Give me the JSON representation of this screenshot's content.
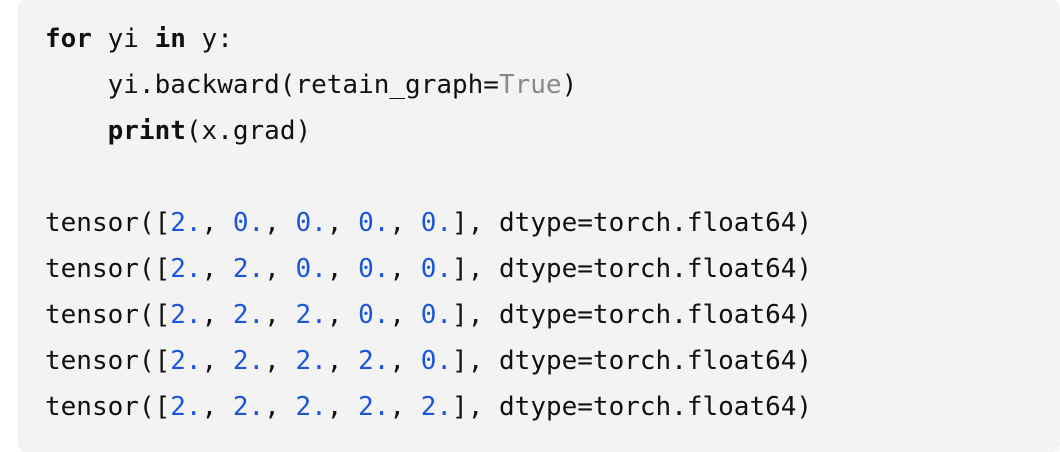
{
  "code": {
    "line1": {
      "kw_for": "for",
      "t1": " yi ",
      "kw_in": "in",
      "t2": " y:"
    },
    "line2": {
      "indent": "    ",
      "t1": "yi.backward(retain_graph=",
      "const": "True",
      "t2": ")"
    },
    "line3": {
      "indent": "    ",
      "kw_print": "print",
      "t1": "(x.grad)"
    }
  },
  "output": {
    "rows": [
      {
        "prefix": "tensor([",
        "v": [
          "2.",
          "0.",
          "0.",
          "0.",
          "0."
        ],
        "sep": ", ",
        "suffix": "], dtype=torch.float64)"
      },
      {
        "prefix": "tensor([",
        "v": [
          "2.",
          "2.",
          "0.",
          "0.",
          "0."
        ],
        "sep": ", ",
        "suffix": "], dtype=torch.float64)"
      },
      {
        "prefix": "tensor([",
        "v": [
          "2.",
          "2.",
          "2.",
          "0.",
          "0."
        ],
        "sep": ", ",
        "suffix": "], dtype=torch.float64)"
      },
      {
        "prefix": "tensor([",
        "v": [
          "2.",
          "2.",
          "2.",
          "2.",
          "0."
        ],
        "sep": ", ",
        "suffix": "], dtype=torch.float64)"
      },
      {
        "prefix": "tensor([",
        "v": [
          "2.",
          "2.",
          "2.",
          "2.",
          "2."
        ],
        "sep": ", ",
        "suffix": "], dtype=torch.float64)"
      }
    ]
  },
  "colors": {
    "background": "#f3f3f3",
    "keyword": "#111111",
    "constant": "#8a8a8a",
    "number": "#1a56db"
  }
}
